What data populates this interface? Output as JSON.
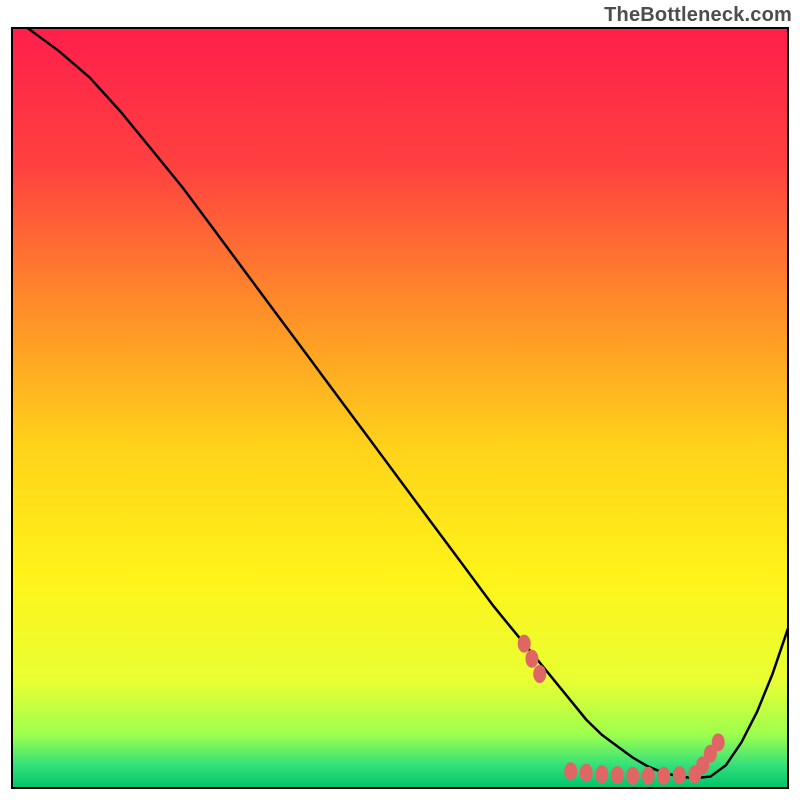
{
  "watermark": "TheBottleneck.com",
  "chart_data": {
    "type": "line",
    "title": "",
    "xlabel": "",
    "ylabel": "",
    "xlim": [
      0,
      100
    ],
    "ylim": [
      0,
      100
    ],
    "grid": false,
    "legend": false,
    "background_gradient": {
      "stops": [
        {
          "offset": 0.0,
          "color": "#ff1f4b"
        },
        {
          "offset": 0.18,
          "color": "#ff4040"
        },
        {
          "offset": 0.36,
          "color": "#ff8a2a"
        },
        {
          "offset": 0.55,
          "color": "#ffd21a"
        },
        {
          "offset": 0.72,
          "color": "#fff31a"
        },
        {
          "offset": 0.86,
          "color": "#e8ff33"
        },
        {
          "offset": 0.93,
          "color": "#9dff4d"
        },
        {
          "offset": 0.97,
          "color": "#33e07a"
        },
        {
          "offset": 1.0,
          "color": "#00c46a"
        }
      ]
    },
    "series": [
      {
        "name": "bottleneck-curve",
        "color": "#000000",
        "x": [
          2,
          6,
          10,
          14,
          18,
          22,
          26,
          30,
          34,
          38,
          42,
          46,
          50,
          54,
          58,
          62,
          64,
          66,
          68,
          70,
          72,
          74,
          76,
          78,
          80,
          82,
          84,
          86,
          88,
          90,
          92,
          94,
          96,
          98,
          100
        ],
        "y": [
          100,
          97,
          93.5,
          89,
          84,
          79,
          73.5,
          68,
          62.5,
          57,
          51.5,
          46,
          40.5,
          35,
          29.5,
          24,
          21.5,
          19,
          16.5,
          14,
          11.5,
          9,
          7,
          5.5,
          4,
          2.8,
          2,
          1.5,
          1.3,
          1.5,
          3,
          6,
          10,
          15,
          21
        ]
      }
    ],
    "markers": {
      "name": "highlighted-points",
      "color": "#e06666",
      "points": [
        {
          "x": 66,
          "y": 19
        },
        {
          "x": 67,
          "y": 17
        },
        {
          "x": 68,
          "y": 15
        },
        {
          "x": 72,
          "y": 2.2
        },
        {
          "x": 74,
          "y": 2.0
        },
        {
          "x": 76,
          "y": 1.8
        },
        {
          "x": 78,
          "y": 1.7
        },
        {
          "x": 80,
          "y": 1.6
        },
        {
          "x": 82,
          "y": 1.6
        },
        {
          "x": 84,
          "y": 1.6
        },
        {
          "x": 86,
          "y": 1.7
        },
        {
          "x": 88,
          "y": 1.8
        },
        {
          "x": 89,
          "y": 3.0
        },
        {
          "x": 90,
          "y": 4.5
        },
        {
          "x": 91,
          "y": 6.0
        }
      ]
    }
  }
}
